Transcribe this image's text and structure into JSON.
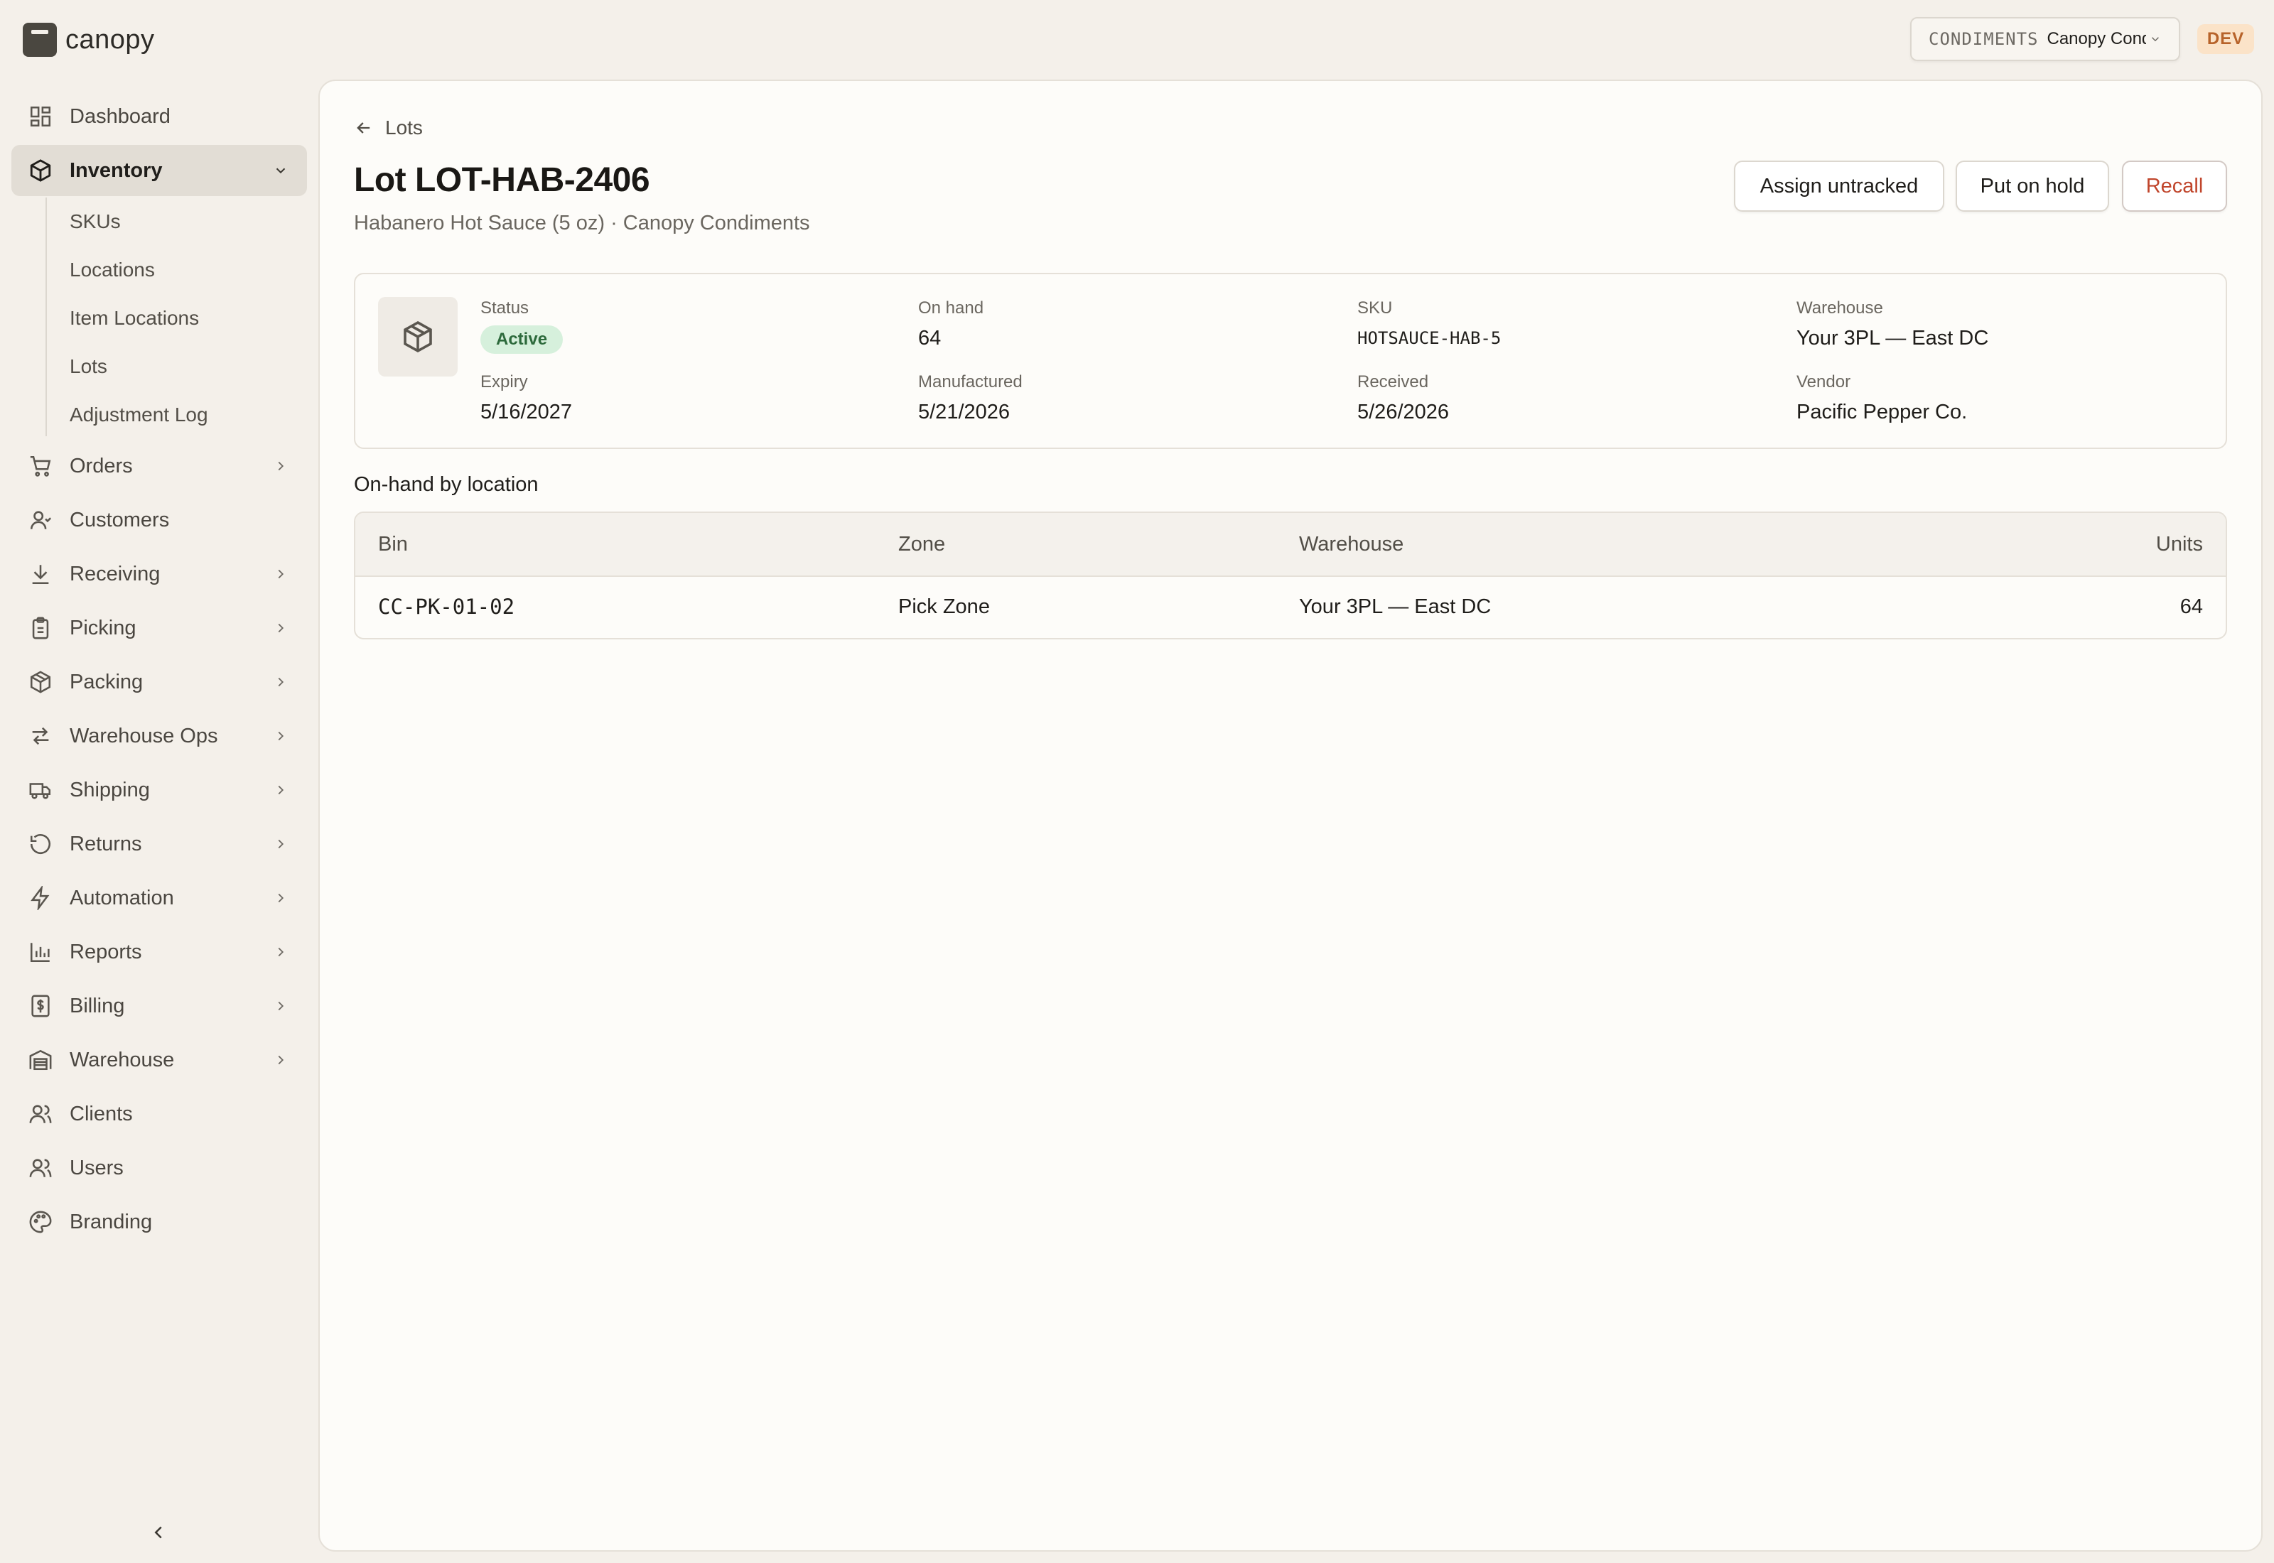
{
  "app": {
    "logo_text": "canopy",
    "client_code": "CONDIMENTS",
    "client_name": "Canopy Condiments",
    "env_badge": "DEV"
  },
  "sidebar": {
    "items": [
      {
        "label": "Dashboard",
        "icon": "dashboard-icon"
      },
      {
        "label": "Inventory",
        "icon": "box-icon",
        "expanded": true
      },
      {
        "label": "Orders",
        "icon": "cart-icon"
      },
      {
        "label": "Customers",
        "icon": "customer-icon"
      },
      {
        "label": "Receiving",
        "icon": "download-icon"
      },
      {
        "label": "Picking",
        "icon": "clipboard-icon"
      },
      {
        "label": "Packing",
        "icon": "package-icon"
      },
      {
        "label": "Warehouse Ops",
        "icon": "transfer-arrows-icon"
      },
      {
        "label": "Shipping",
        "icon": "truck-icon"
      },
      {
        "label": "Returns",
        "icon": "return-icon"
      },
      {
        "label": "Automation",
        "icon": "lightning-icon"
      },
      {
        "label": "Reports",
        "icon": "bar-chart-icon"
      },
      {
        "label": "Billing",
        "icon": "dollar-icon"
      },
      {
        "label": "Warehouse",
        "icon": "warehouse-icon"
      },
      {
        "label": "Clients",
        "icon": "users-icon"
      },
      {
        "label": "Users",
        "icon": "user-group-icon"
      },
      {
        "label": "Branding",
        "icon": "palette-icon"
      }
    ],
    "inventory_sub": [
      "SKUs",
      "Locations",
      "Item Locations",
      "Lots",
      "Adjustment Log"
    ]
  },
  "page": {
    "back_label": "Lots",
    "title": "Lot LOT-HAB-2406",
    "subtitle": "Habanero Hot Sauce (5 oz) · Canopy Condiments",
    "actions": {
      "assign": "Assign untracked",
      "hold": "Put on hold",
      "recall": "Recall"
    }
  },
  "summary": {
    "status_label": "Status",
    "status_value": "Active",
    "on_hand_label": "On hand",
    "on_hand_value": "64",
    "sku_label": "SKU",
    "sku_value": "HOTSAUCE-HAB-5",
    "warehouse_label": "Warehouse",
    "warehouse_value": "Your 3PL — East DC",
    "expiry_label": "Expiry",
    "expiry_value": "5/16/2027",
    "manufactured_label": "Manufactured",
    "manufactured_value": "5/21/2026",
    "received_label": "Received",
    "received_value": "5/26/2026",
    "vendor_label": "Vendor",
    "vendor_value": "Pacific Pepper Co."
  },
  "onhand": {
    "section_title": "On-hand by location",
    "columns": [
      "Bin",
      "Zone",
      "Warehouse",
      "Units"
    ],
    "rows": [
      {
        "bin": "CC-PK-01-02",
        "zone": "Pick Zone",
        "warehouse": "Your 3PL — East DC",
        "units": "64"
      }
    ]
  },
  "colors": {
    "accent_recall": "#c0452b",
    "status_active_bg": "#d6f0dc",
    "status_active_text": "#2d6a3c",
    "env_badge_bg": "#fbe3c8"
  }
}
